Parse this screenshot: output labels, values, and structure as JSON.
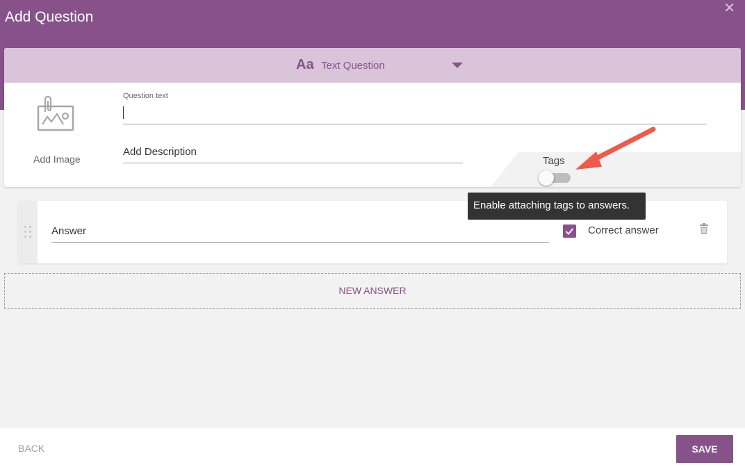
{
  "header": {
    "title": "Add Question",
    "close_glyph": "✕"
  },
  "question_type": {
    "icon_text": "Aa",
    "label": "Text Question"
  },
  "image": {
    "icon": "image-icon",
    "label": "Add Image"
  },
  "question_text": {
    "label": "Question text",
    "value": ""
  },
  "description": {
    "placeholder": "Add Description"
  },
  "tags": {
    "label": "Tags",
    "enabled": false,
    "tooltip": "Enable attaching tags to answers."
  },
  "answers": [
    {
      "placeholder": "Answer",
      "correct": true,
      "correct_label": "Correct answer"
    }
  ],
  "new_answer_label": "NEW ANSWER",
  "footer": {
    "back_label": "BACK",
    "save_label": "SAVE"
  },
  "colors": {
    "brand": "#87528a",
    "brand_light": "#d9c4da",
    "annotation_arrow": "#f05a4a",
    "tooltip_bg": "#333333"
  }
}
